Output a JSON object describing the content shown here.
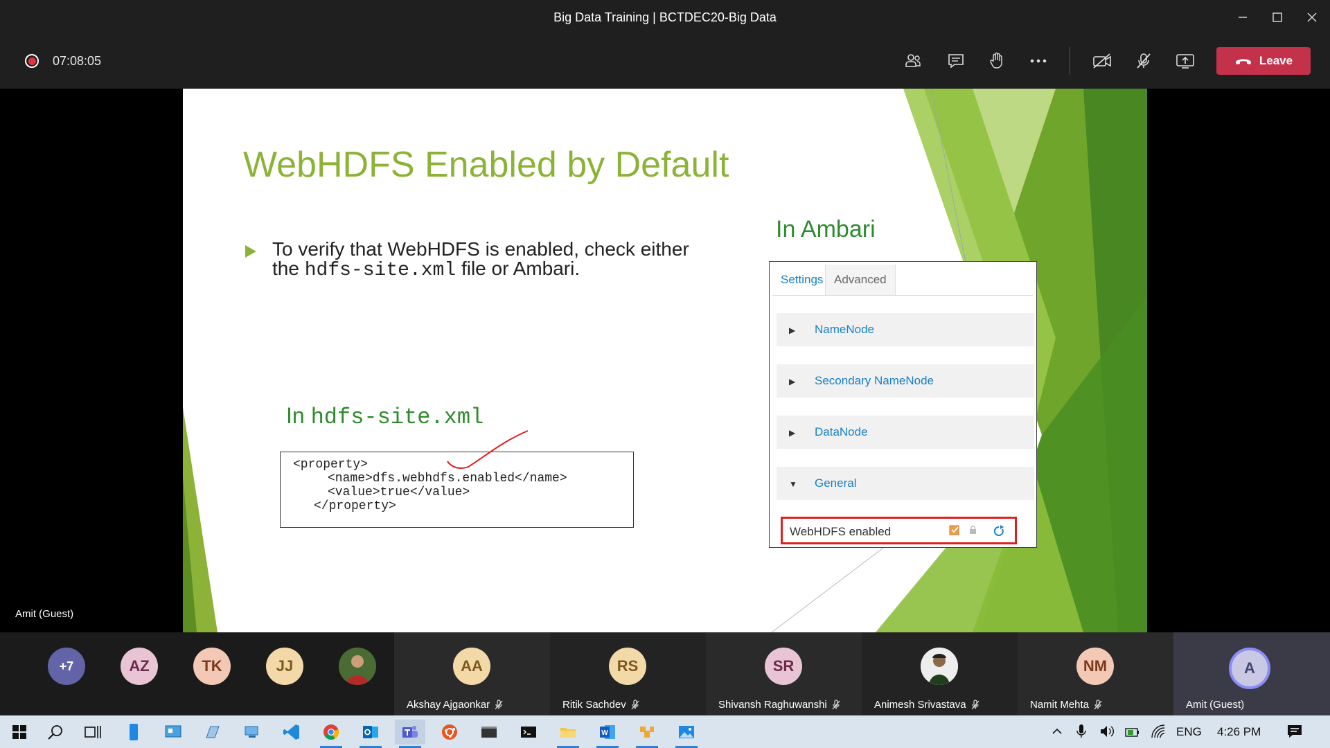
{
  "window": {
    "title": "Big Data Training | BCTDEC20-Big Data"
  },
  "toolbar": {
    "timer": "07:08:05",
    "leave_label": "Leave",
    "icons": [
      "participants-icon",
      "chat-icon",
      "raise-hand-icon",
      "more-icon",
      "camera-off-icon",
      "mic-off-icon",
      "share-screen-icon"
    ]
  },
  "slide": {
    "title": "WebHDFS Enabled by Default",
    "bullet_prefix": "To verify that WebHDFS is enabled, check either the",
    "bullet_code": "hdfs-site.xml",
    "bullet_suffix": "file or Ambari.",
    "hdfs_heading_prefix": "In",
    "hdfs_heading_code": "hdfs-site.xml",
    "xml_lines": [
      "<property>",
      "<name>dfs.webhdfs.enabled</name>",
      "<value>true</value>",
      "</property>"
    ],
    "ambari_heading": "In Ambari",
    "ambari": {
      "tabs": [
        "Settings",
        "Advanced"
      ],
      "sections": [
        "NameNode",
        "Secondary NameNode",
        "DataNode",
        "General"
      ],
      "setting_label": "WebHDFS enabled",
      "setting_checked": true
    }
  },
  "speaker_label": "Amit (Guest)",
  "participants": {
    "overflow": "+7",
    "avatars": [
      {
        "initials": "AZ",
        "color": "#e8c4d4"
      },
      {
        "initials": "TK",
        "color": "#f3c9b5"
      },
      {
        "initials": "JJ",
        "color": "#f3d9a8"
      }
    ],
    "tiles": [
      {
        "initials": "AA",
        "name": "Akshay Ajgaonkar",
        "color": "#f3d9a8"
      },
      {
        "initials": "RS",
        "name": "Ritik Sachdev",
        "color": "#f3d9a8"
      },
      {
        "initials": "SR",
        "name": "Shivansh Raghuwanshi",
        "color": "#e8c4d4"
      },
      {
        "initials": "",
        "name": "Animesh Srivastava",
        "color": "#8a6a4a"
      },
      {
        "initials": "NM",
        "name": "Namit Mehta",
        "color": "#f3c9b5"
      },
      {
        "initials": "A",
        "name": "Amit (Guest)",
        "color": "#c9c9e6"
      }
    ]
  },
  "taskbar": {
    "tray_lang": "ENG",
    "tray_time": "4:26 PM"
  }
}
